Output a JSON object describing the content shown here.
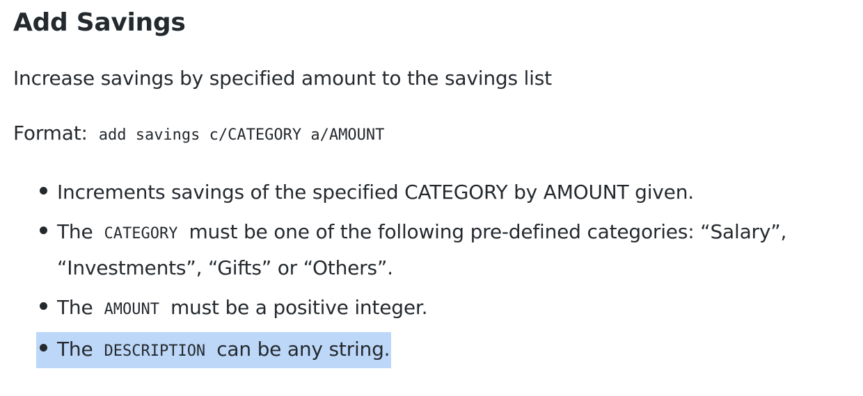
{
  "section": {
    "title": "Add Savings",
    "description": "Increase savings by specified amount to the savings list",
    "format_label": "Format:",
    "format_code": "add savings c/CATEGORY a/AMOUNT"
  },
  "notes": [
    {
      "text": "Increments savings of the specified CATEGORY by AMOUNT given."
    },
    {
      "prefix": "The",
      "code": "CATEGORY",
      "suffix": "must be one of the following pre-defined categories: “Salary”,",
      "continuation": "“Investments”, “Gifts” or “Others”."
    },
    {
      "prefix": "The",
      "code": "AMOUNT",
      "suffix": "must be a positive integer."
    },
    {
      "prefix": "The",
      "code": "DESCRIPTION",
      "suffix": "can be any string."
    }
  ],
  "colors": {
    "selection_highlight": "#bdd7f8",
    "text": "#24292e"
  }
}
